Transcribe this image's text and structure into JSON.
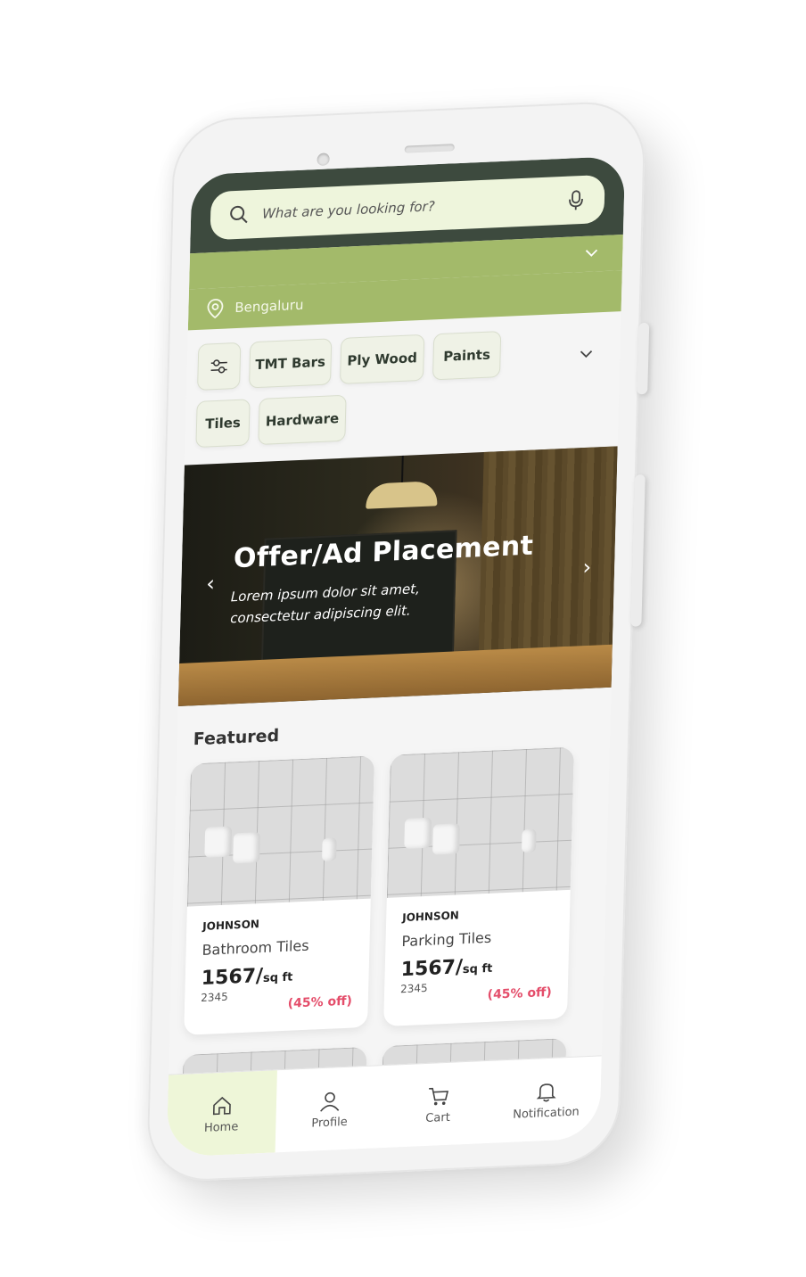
{
  "search": {
    "placeholder": "What are you looking for?"
  },
  "location": {
    "city": "Bengaluru"
  },
  "categories": [
    "TMT Bars",
    "Ply Wood",
    "Paints",
    "Tiles",
    "Hardware"
  ],
  "banner": {
    "title": "Offer/Ad Placement",
    "subtitle_line1": "Lorem ipsum dolor sit amet,",
    "subtitle_line2": "consectetur adipiscing elit."
  },
  "featured_title": "Featured",
  "products": [
    {
      "brand": "JOHNSON",
      "name": "Bathroom Tiles",
      "price": "1567/",
      "unit": "sq ft",
      "code": "2345",
      "discount": "(45% off)"
    },
    {
      "brand": "JOHNSON",
      "name": "Parking Tiles",
      "price": "1567/",
      "unit": "sq ft",
      "code": "2345",
      "discount": "(45% off)"
    }
  ],
  "nav": [
    {
      "label": "Home",
      "icon": "home-icon"
    },
    {
      "label": "Profile",
      "icon": "profile-icon"
    },
    {
      "label": "Cart",
      "icon": "cart-icon"
    },
    {
      "label": "Notification",
      "icon": "bell-icon"
    }
  ],
  "colors": {
    "header_dark": "#3d4a3e",
    "accent_green": "#a3ba6a",
    "search_bg": "#eef5dc",
    "discount_red": "#e44d6a"
  }
}
